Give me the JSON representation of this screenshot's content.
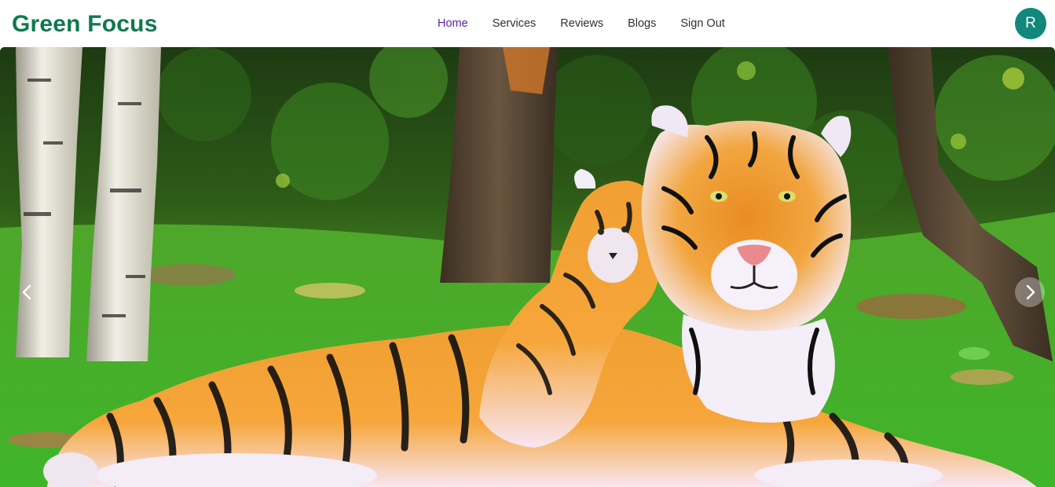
{
  "navbar": {
    "brand": "Green Focus",
    "links": [
      {
        "label": "Home",
        "active": true
      },
      {
        "label": "Services",
        "active": false
      },
      {
        "label": "Reviews",
        "active": false
      },
      {
        "label": "Blogs",
        "active": false
      },
      {
        "label": "Sign Out",
        "active": false
      }
    ],
    "avatar_initial": "R"
  },
  "hero": {
    "image_subject": "tiger-with-cub-photo",
    "prev_icon": "chevron-left-icon",
    "next_icon": "chevron-right-icon"
  },
  "colors": {
    "brand": "#0c7a4e",
    "active_link": "#5a1fa8",
    "avatar_bg": "#12877b"
  }
}
